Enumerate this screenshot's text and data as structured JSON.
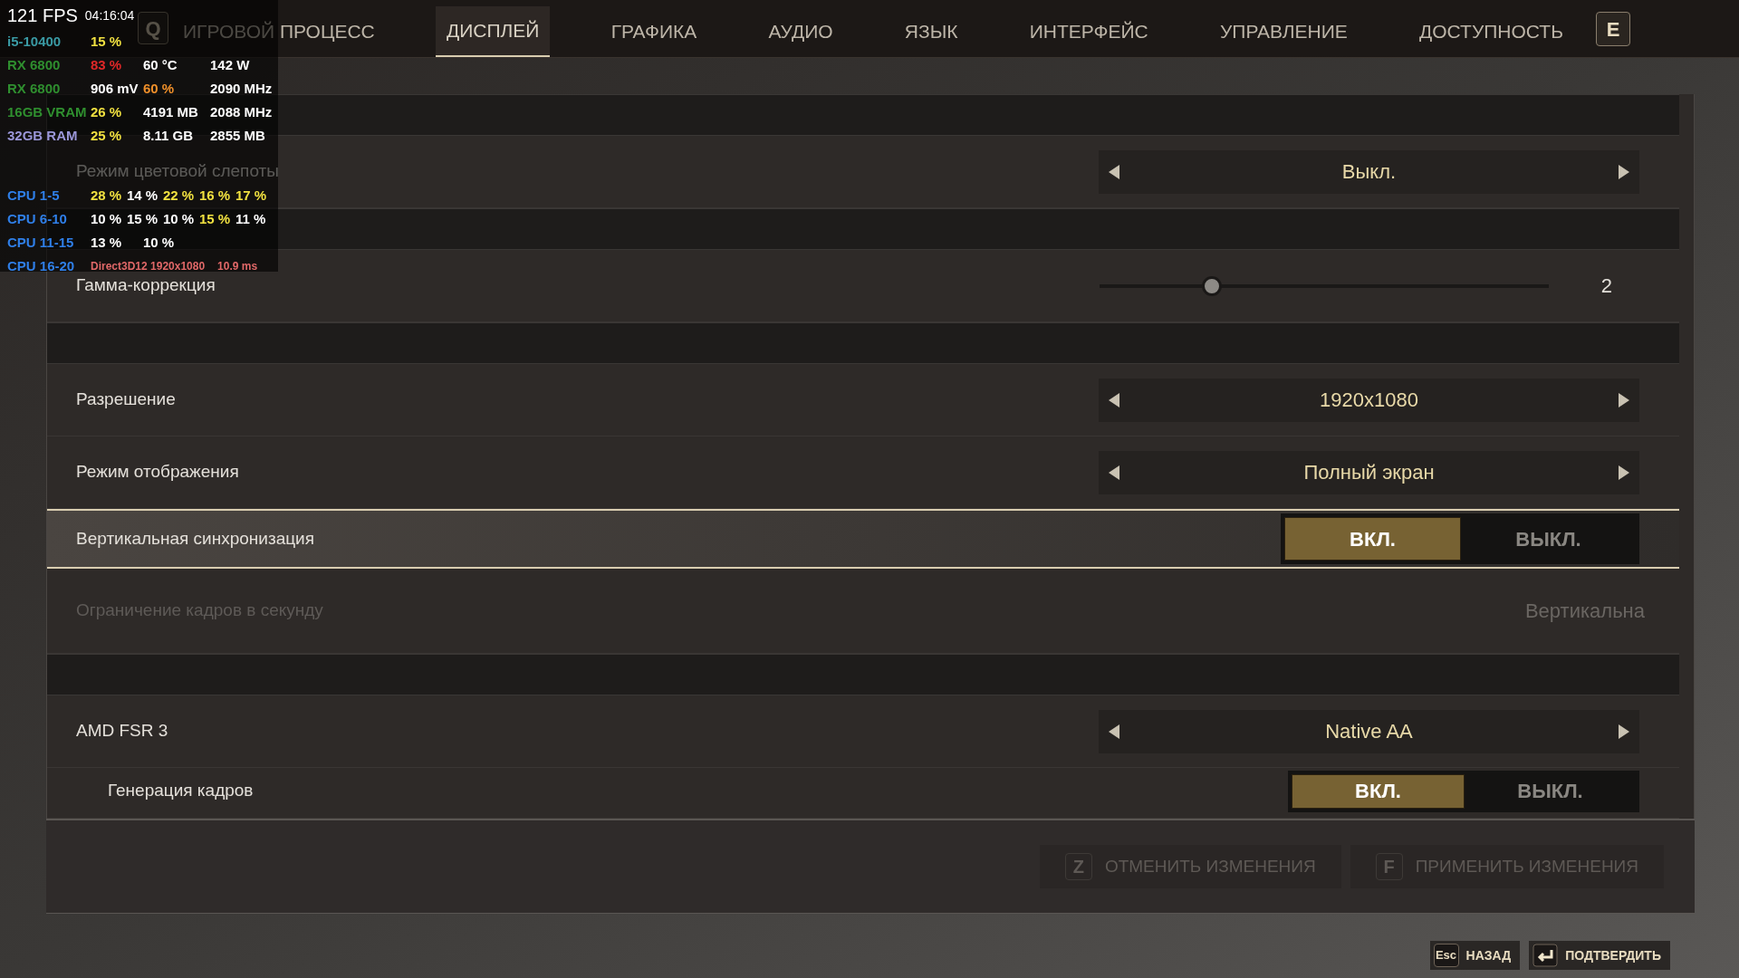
{
  "tabs_bar": {
    "prev_key": "Q",
    "next_key": "E",
    "tabs": [
      {
        "label": "ИГРОВОЙ ПРОЦЕСС",
        "selected": false
      },
      {
        "label": "ДИСПЛЕЙ",
        "selected": true
      },
      {
        "label": "ГРАФИКА",
        "selected": false
      },
      {
        "label": "АУДИО",
        "selected": false
      },
      {
        "label": "ЯЗЫК",
        "selected": false
      },
      {
        "label": "ИНТЕРФЕЙС",
        "selected": false
      },
      {
        "label": "УПРАВЛЕНИЕ",
        "selected": false
      },
      {
        "label": "ДОСТУПНОСТЬ",
        "selected": false
      }
    ]
  },
  "settings": [
    {
      "kind": "band"
    },
    {
      "kind": "selector",
      "label": "Режим цветовой слепоты",
      "value": "Выкл."
    },
    {
      "kind": "band"
    },
    {
      "kind": "slider",
      "label": "Гамма-коррекция",
      "level": 0.25,
      "reading": "2"
    },
    {
      "kind": "band"
    },
    {
      "kind": "selector",
      "label": "Разрешение",
      "value": "1920x1080"
    },
    {
      "kind": "selector",
      "label": "Режим отображения",
      "value": "Полный экран"
    },
    {
      "kind": "toggle",
      "label": "Вертикальная синхронизация",
      "focused": true,
      "options": [
        {
          "label": "ВКЛ.",
          "selected": true
        },
        {
          "label": "ВЫКЛ.",
          "selected": false
        }
      ]
    },
    {
      "kind": "disabled",
      "label": "Ограничение кадров в секунду",
      "value": "Вертикальна"
    },
    {
      "kind": "band"
    },
    {
      "kind": "selector",
      "label": "AMD FSR 3",
      "value": "Native AA",
      "children": [
        {
          "kind": "toggle",
          "label": "Генерация кадров",
          "focused": false,
          "options": [
            {
              "label": "ВКЛ.",
              "selected": true
            },
            {
              "label": "ВЫКЛ.",
              "selected": false
            }
          ]
        }
      ]
    }
  ],
  "actions": [
    {
      "key": "Z",
      "label": "ОТМЕНИТЬ ИЗМЕНЕНИЯ",
      "disabled": true
    },
    {
      "key": "F",
      "label": "ПРИМЕНИТЬ ИЗМЕНЕНИЯ",
      "disabled": true
    }
  ],
  "hints": [
    {
      "kind": "text",
      "key": "Esc",
      "label": "НАЗАД"
    },
    {
      "kind": "enter",
      "label": "ПОДТВЕРДИТЬ"
    }
  ],
  "overlay": {
    "fps": "121 FPS",
    "time": "04:16:04",
    "lines": [
      [
        {
          "text": "i5-10400",
          "color": "#3a9aa4"
        },
        {
          "text": "15 %",
          "color": "#f0e040"
        }
      ],
      [
        {
          "text": "RX 6800",
          "color": "#2f8f2f"
        },
        {
          "text": "83 %",
          "color": "#e02828"
        },
        {
          "text": "60 °C",
          "color": "#ffffff"
        },
        {
          "text": "142 W",
          "color": "#ffffff"
        }
      ],
      [
        {
          "text": "RX 6800",
          "color": "#2f8f2f"
        },
        {
          "text": "906 mV",
          "color": "#ffffff"
        },
        {
          "text": "60 %",
          "color": "#f0902a"
        },
        {
          "text": "2090 MHz",
          "color": "#ffffff"
        }
      ],
      [
        {
          "text": "16GB VRAM",
          "color": "#2f8f2f"
        },
        {
          "text": "26 %",
          "color": "#f0e040"
        },
        {
          "text": "4191 MB",
          "color": "#ffffff"
        },
        {
          "text": "2088 MHz",
          "color": "#ffffff"
        }
      ],
      [
        {
          "text": "32GB RAM",
          "color": "#9a96d8"
        },
        {
          "text": "25 %",
          "color": "#f0e040"
        },
        {
          "text": "8.11 GB",
          "color": "#ffffff"
        },
        {
          "text": "2855 MB",
          "color": "#ffffff"
        }
      ],
      [
        {
          "text": "CPU 1-5",
          "color": "#2f7fe8"
        },
        {
          "text": "28 %",
          "color": "#f0e040"
        },
        {
          "text": "14 %",
          "color": "#ffffff"
        },
        {
          "text": "22 %",
          "color": "#f0e040"
        },
        {
          "text": "16 %",
          "color": "#f0e040"
        },
        {
          "text": "17 %",
          "color": "#f0e040"
        }
      ],
      [
        {
          "text": "CPU 6-10",
          "color": "#2f7fe8"
        },
        {
          "text": "10 %",
          "color": "#ffffff"
        },
        {
          "text": "15 %",
          "color": "#ffffff"
        },
        {
          "text": "10 %",
          "color": "#ffffff"
        },
        {
          "text": "15 %",
          "color": "#f0e040"
        },
        {
          "text": "11 %",
          "color": "#ffffff"
        }
      ],
      [
        {
          "text": "CPU 11-15",
          "color": "#2f7fe8"
        },
        {
          "text": "13 %",
          "color": "#ffffff"
        },
        {
          "text": "10 %",
          "color": "#ffffff"
        }
      ],
      [
        {
          "text": "CPU 16-20",
          "color": "#2f7fe8"
        },
        {
          "text": "Direct3D12 1920x1080",
          "color": "#e06868"
        },
        {
          "text": "10.9 ms",
          "color": "#e06868"
        }
      ]
    ]
  }
}
